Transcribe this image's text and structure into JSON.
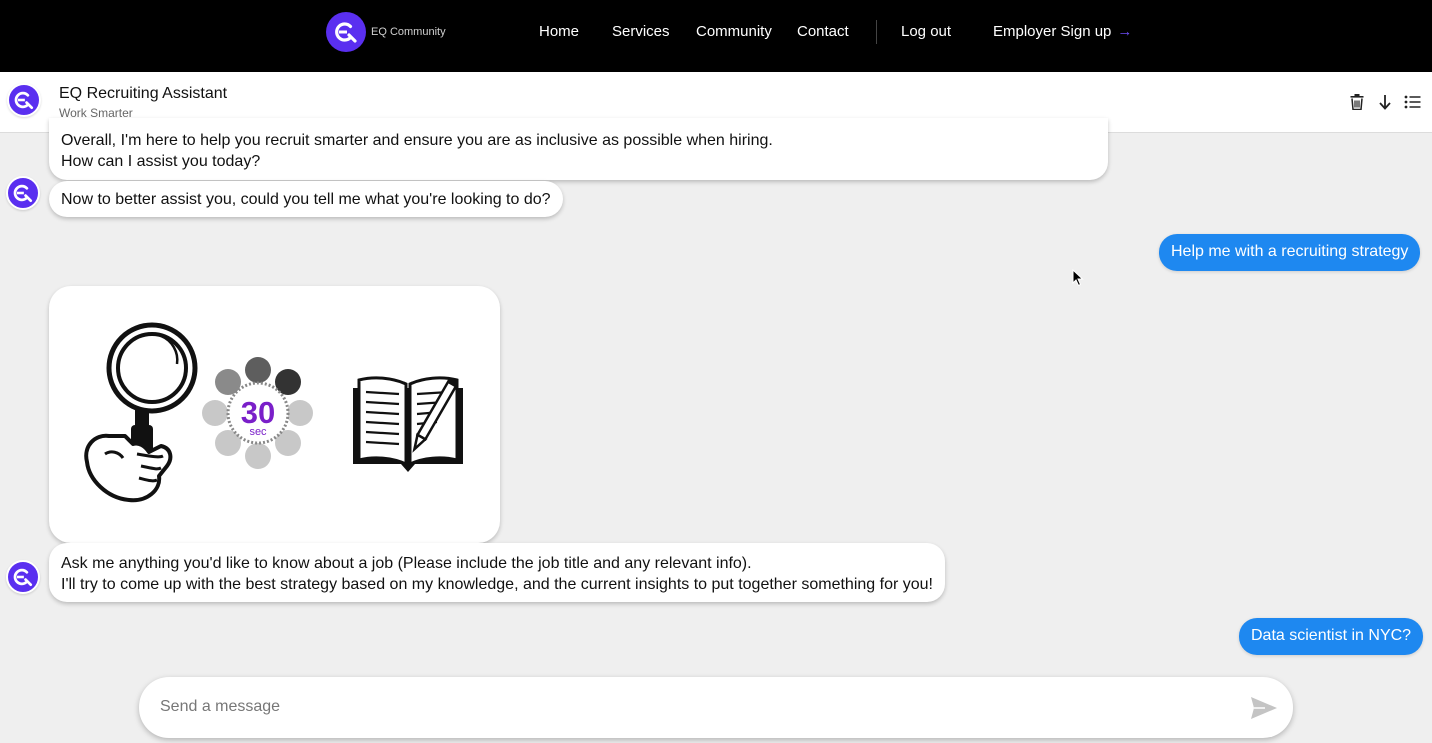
{
  "brand": {
    "name": "EQ Community"
  },
  "nav": {
    "items": [
      {
        "label": "Home"
      },
      {
        "label": "Services"
      },
      {
        "label": "Community"
      },
      {
        "label": "Contact"
      },
      {
        "label": "Log out"
      }
    ],
    "signup_label": "Employer Sign up",
    "signup_arrow": "→"
  },
  "chat_header": {
    "title": "EQ Recruiting Assistant",
    "subtitle": "Work Smarter"
  },
  "messages": [
    {
      "sender": "bot",
      "lines": [
        "Overall, I'm here to help you recruit smarter and ensure you are as inclusive as possible when hiring.",
        "How can I assist you today?"
      ]
    },
    {
      "sender": "bot",
      "lines": [
        "Now to better assist you, could you tell me what you're looking to do?"
      ]
    },
    {
      "sender": "user",
      "text": "Help me with a recruiting strategy"
    },
    {
      "sender": "bot",
      "type": "image",
      "timer": {
        "number": "30",
        "unit": "sec"
      }
    },
    {
      "sender": "bot",
      "lines": [
        "Ask me anything you'd like to know about a job (Please include the job title and any relevant info).",
        "I'll try to come up with the best strategy based on my knowledge, and the current insights to put together something for you!"
      ]
    },
    {
      "sender": "user",
      "text": "Data scientist in NYC?"
    }
  ],
  "composer": {
    "placeholder": "Send a message"
  },
  "colors": {
    "accent": "#5a2ff0",
    "user_bubble": "#1e88f0",
    "nav_bg": "#000000",
    "timer_text": "#7a1fc9"
  }
}
